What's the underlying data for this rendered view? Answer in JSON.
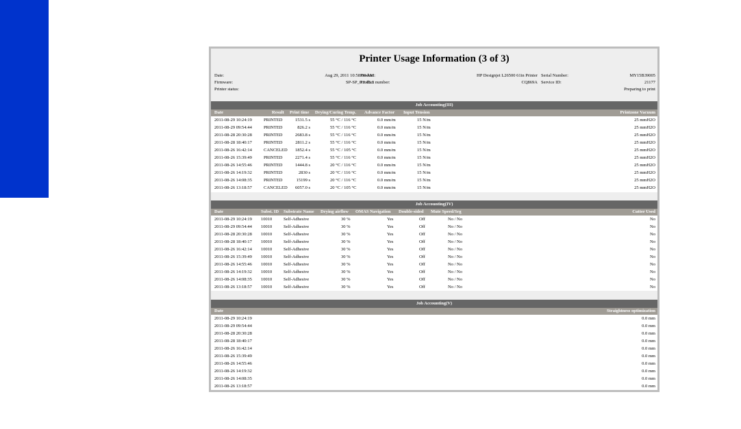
{
  "report": {
    "title": "Printer Usage Information (3 of 3)",
    "info": {
      "date_label": "Date:",
      "date_value": "Aug 29, 2011 10:58:00 AM",
      "product_label": "Product:",
      "product_value": "HP Designjet L26500 61in Printer",
      "serial_label": "Serial Number:",
      "serial_value": "MY15B39005",
      "firmware_label": "Firmware:",
      "firmware_value": "SP-SP_0.0.15.1",
      "product_number_label": "Product number:",
      "product_number_value": "CQ869A",
      "service_id_label": "Service ID:",
      "service_id_value": "21177",
      "printer_status_label": "Printer status:",
      "printer_status_value": "Preparing to print"
    }
  },
  "section3": {
    "title": "Job Accounting(III)",
    "headers": {
      "date": "Date",
      "result": "Result",
      "print_time": "Print time",
      "drying": "Drying/Curing Temp.",
      "advance": "Advance Factor",
      "tension": "Input Tension",
      "vacuum": "Printzone Vacuum"
    },
    "rows": [
      {
        "date": "2011-08-29 10:24:19",
        "result": "PRINTED",
        "print_time": "1531.5 s",
        "drying": "55 °C / 116 °C",
        "advance": "0.0 mm/m",
        "tension": "15 N/m",
        "vacuum": "25 mmH2O"
      },
      {
        "date": "2011-08-29 09:54:44",
        "result": "PRINTED",
        "print_time": "826.2 s",
        "drying": "55 °C / 116 °C",
        "advance": "0.0 mm/m",
        "tension": "15 N/m",
        "vacuum": "25 mmH2O"
      },
      {
        "date": "2011-08-28 20:30:28",
        "result": "PRINTED",
        "print_time": "2683.8 s",
        "drying": "55 °C / 116 °C",
        "advance": "0.0 mm/m",
        "tension": "15 N/m",
        "vacuum": "25 mmH2O"
      },
      {
        "date": "2011-08-28 18:40:17",
        "result": "PRINTED",
        "print_time": "2811.2 s",
        "drying": "55 °C / 116 °C",
        "advance": "0.0 mm/m",
        "tension": "15 N/m",
        "vacuum": "25 mmH2O"
      },
      {
        "date": "2011-08-26 16:42:14",
        "result": "CANCELED",
        "print_time": "1852.4 s",
        "drying": "55 °C / 105 °C",
        "advance": "0.0 mm/m",
        "tension": "15 N/m",
        "vacuum": "25 mmH2O"
      },
      {
        "date": "2011-08-26 15:39:49",
        "result": "PRINTED",
        "print_time": "2271.4 s",
        "drying": "55 °C / 116 °C",
        "advance": "0.0 mm/m",
        "tension": "15 N/m",
        "vacuum": "25 mmH2O"
      },
      {
        "date": "2011-08-26 14:55:46",
        "result": "PRINTED",
        "print_time": "1444.8 s",
        "drying": "20 °C / 116 °C",
        "advance": "0.0 mm/m",
        "tension": "15 N/m",
        "vacuum": "25 mmH2O"
      },
      {
        "date": "2011-08-26 14:19:32",
        "result": "PRINTED",
        "print_time": "2830 s",
        "drying": "20 °C / 116 °C",
        "advance": "0.0 mm/m",
        "tension": "15 N/m",
        "vacuum": "25 mmH2O"
      },
      {
        "date": "2011-08-26 14:08:35",
        "result": "PRINTED",
        "print_time": "15199 s",
        "drying": "20 °C / 116 °C",
        "advance": "0.0 mm/m",
        "tension": "15 N/m",
        "vacuum": "25 mmH2O"
      },
      {
        "date": "2011-08-26 13:18:57",
        "result": "CANCELED",
        "print_time": "6057.0 s",
        "drying": "20 °C / 105 °C",
        "advance": "0.0 mm/m",
        "tension": "15 N/m",
        "vacuum": "25 mmH2O"
      }
    ]
  },
  "section4": {
    "title": "Job Accounting(IV)",
    "headers": {
      "date": "Date",
      "subst_id": "Subst. ID",
      "subst_name": "Substrate Name",
      "airflow": "Drying airflow",
      "omas": "OMAS Navigation",
      "double": "Double-sided",
      "mute": "Mute Speed/Srg",
      "cutter": "Cutter Used"
    },
    "rows": [
      {
        "date": "2011-08-29 10:24:19",
        "subst_id": "10010",
        "subst_name": "Self-Adhesive",
        "airflow": "30 %",
        "omas": "Yes",
        "double": "Off",
        "mute": "No / No",
        "cutter": "No"
      },
      {
        "date": "2011-08-29 09:54:44",
        "subst_id": "10010",
        "subst_name": "Self-Adhesive",
        "airflow": "30 %",
        "omas": "Yes",
        "double": "Off",
        "mute": "No / No",
        "cutter": "No"
      },
      {
        "date": "2011-08-28 20:30:28",
        "subst_id": "10010",
        "subst_name": "Self-Adhesive",
        "airflow": "30 %",
        "omas": "Yes",
        "double": "Off",
        "mute": "No / No",
        "cutter": "No"
      },
      {
        "date": "2011-08-28 18:40:17",
        "subst_id": "10010",
        "subst_name": "Self-Adhesive",
        "airflow": "30 %",
        "omas": "Yes",
        "double": "Off",
        "mute": "No / No",
        "cutter": "No"
      },
      {
        "date": "2011-08-26 16:42:14",
        "subst_id": "10010",
        "subst_name": "Self-Adhesive",
        "airflow": "30 %",
        "omas": "Yes",
        "double": "Off",
        "mute": "No / No",
        "cutter": "No"
      },
      {
        "date": "2011-08-26 15:39:49",
        "subst_id": "10010",
        "subst_name": "Self-Adhesive",
        "airflow": "30 %",
        "omas": "Yes",
        "double": "Off",
        "mute": "No / No",
        "cutter": "No"
      },
      {
        "date": "2011-08-26 14:55:46",
        "subst_id": "10010",
        "subst_name": "Self-Adhesive",
        "airflow": "30 %",
        "omas": "Yes",
        "double": "Off",
        "mute": "No / No",
        "cutter": "No"
      },
      {
        "date": "2011-08-26 14:19:32",
        "subst_id": "10010",
        "subst_name": "Self-Adhesive",
        "airflow": "30 %",
        "omas": "Yes",
        "double": "Off",
        "mute": "No / No",
        "cutter": "No"
      },
      {
        "date": "2011-08-26 14:08:35",
        "subst_id": "10010",
        "subst_name": "Self-Adhesive",
        "airflow": "30 %",
        "omas": "Yes",
        "double": "Off",
        "mute": "No / No",
        "cutter": "No"
      },
      {
        "date": "2011-08-26 13:18:57",
        "subst_id": "10010",
        "subst_name": "Self-Adhesive",
        "airflow": "30 %",
        "omas": "Yes",
        "double": "Off",
        "mute": "No / No",
        "cutter": "No"
      }
    ]
  },
  "section5": {
    "title": "Job Accounting(V)",
    "headers": {
      "date": "Date",
      "straightness": "Straightness optimization"
    },
    "rows": [
      {
        "date": "2011-08-29 10:24:19",
        "straightness": "0.0 mm"
      },
      {
        "date": "2011-08-29 09:54:44",
        "straightness": "0.0 mm"
      },
      {
        "date": "2011-08-28 20:30:28",
        "straightness": "0.0 mm"
      },
      {
        "date": "2011-08-28 18:40:17",
        "straightness": "0.0 mm"
      },
      {
        "date": "2011-08-26 16:42:14",
        "straightness": "0.0 mm"
      },
      {
        "date": "2011-08-26 15:39:49",
        "straightness": "0.0 mm"
      },
      {
        "date": "2011-08-26 14:55:46",
        "straightness": "0.0 mm"
      },
      {
        "date": "2011-08-26 14:19:32",
        "straightness": "0.0 mm"
      },
      {
        "date": "2011-08-26 14:08:35",
        "straightness": "0.0 mm"
      },
      {
        "date": "2011-08-26 13:18:57",
        "straightness": "0.0 mm"
      }
    ]
  }
}
